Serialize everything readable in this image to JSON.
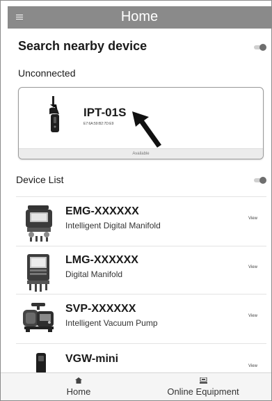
{
  "header": {
    "title": "Home"
  },
  "search": {
    "title": "Search nearby device"
  },
  "unconnected": {
    "label": "Unconnected",
    "device": {
      "name": "IPT-01S",
      "mac": "E7:6A:59:B2:7D:E9",
      "status": "Available"
    }
  },
  "device_list": {
    "label": "Device List",
    "items": [
      {
        "name": "EMG-XXXXXX",
        "description": "Intelligent Digital Manifold",
        "action": "View"
      },
      {
        "name": "LMG-XXXXXX",
        "description": "Digital Manifold",
        "action": "View"
      },
      {
        "name": "SVP-XXXXXX",
        "description": "Intelligent Vacuum Pump",
        "action": "View"
      },
      {
        "name": "VGW-mini",
        "description": "",
        "action": "View"
      }
    ]
  },
  "bottom_nav": {
    "tabs": [
      {
        "label": "Home",
        "icon": "home-icon"
      },
      {
        "label": "Online Equipment",
        "icon": "equipment-icon"
      }
    ]
  },
  "colors": {
    "header_bg": "#8a8a8a",
    "toggle_knob": "#6e6e6e",
    "card_footer": "#ececec"
  }
}
